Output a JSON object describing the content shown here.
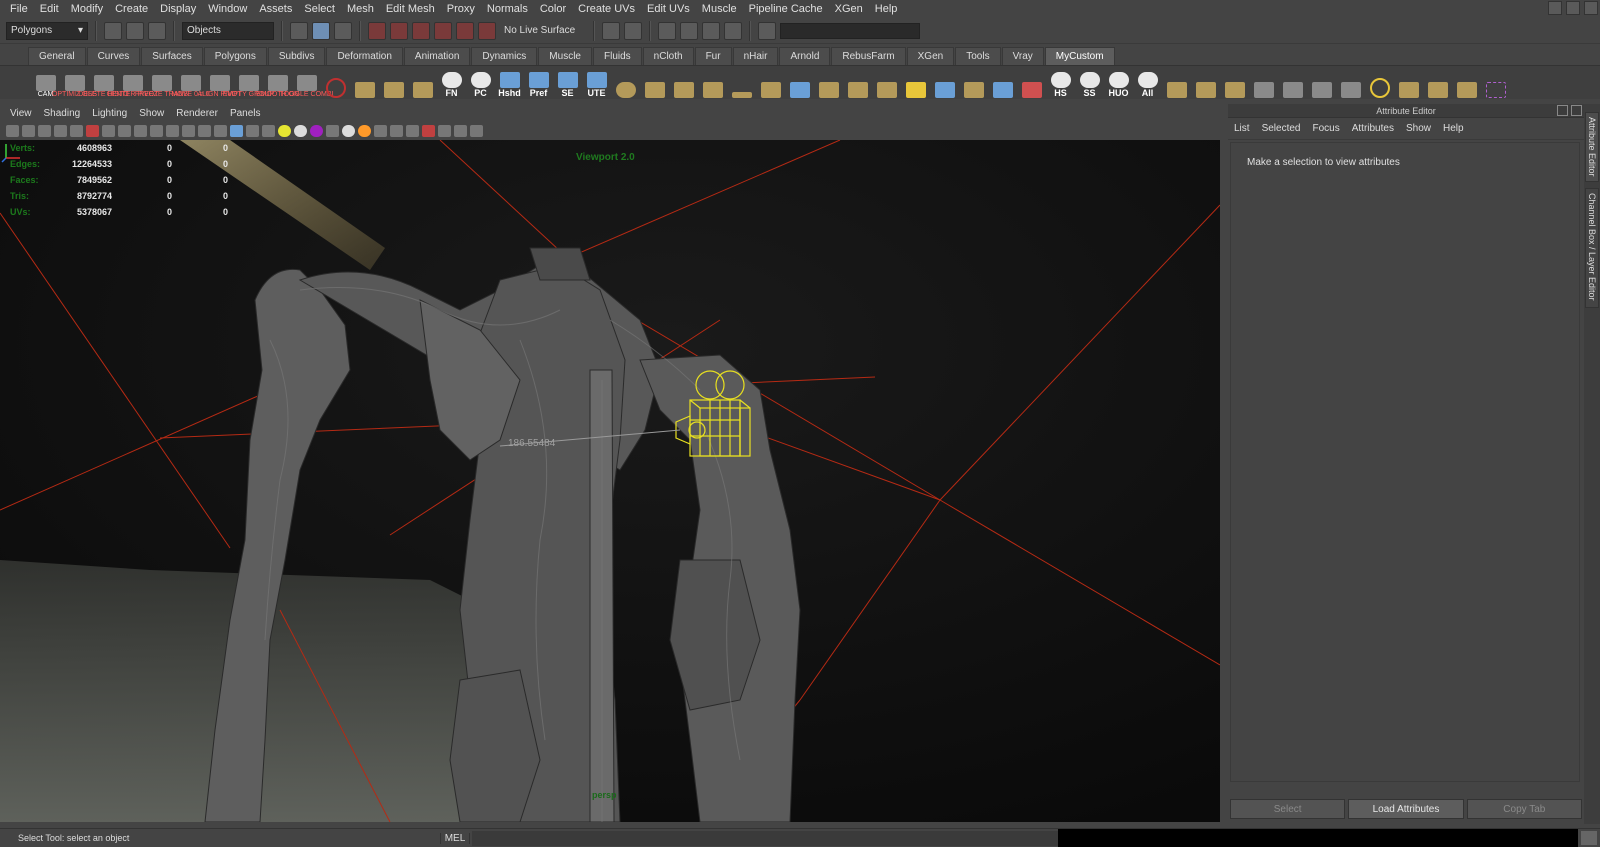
{
  "menubar": {
    "items": [
      "File",
      "Edit",
      "Modify",
      "Create",
      "Display",
      "Window",
      "Assets",
      "Select",
      "Mesh",
      "Edit Mesh",
      "Proxy",
      "Normals",
      "Color",
      "Create UVs",
      "Edit UVs",
      "Muscle",
      "Pipeline Cache",
      "XGen",
      "Help"
    ]
  },
  "statusline": {
    "menuset": "Polygons",
    "select_mode": "Objects",
    "live_surface": "No Live Surface"
  },
  "shelf": {
    "tabs": [
      "General",
      "Curves",
      "Surfaces",
      "Polygons",
      "Subdivs",
      "Deformation",
      "Animation",
      "Dynamics",
      "Muscle",
      "Fluids",
      "nCloth",
      "Fur",
      "nHair",
      "Arnold",
      "RebusFarm",
      "XGen",
      "Tools",
      "Vray",
      "MyCustom"
    ],
    "active_tab": "MyCustom",
    "buttons": [
      {
        "label": "CAM",
        "type": "white"
      },
      {
        "label": "OPTIMIZ OSS",
        "type": "red"
      },
      {
        "label": "DELETE HISTO",
        "type": "red"
      },
      {
        "label": "CENTER PIVOT",
        "type": "red"
      },
      {
        "label": "FREEZE TRANS",
        "type": "red"
      },
      {
        "label": "MOVE 0 n 0",
        "type": "red"
      },
      {
        "label": "ALIGN PIVOT",
        "type": "red"
      },
      {
        "label": "EMPTY GROUP",
        "type": "red"
      },
      {
        "label": "SMOOTH ON",
        "type": "red"
      },
      {
        "label": "TOGGLE COMBI",
        "type": "red"
      },
      {
        "label": "FN",
        "type": "eye"
      },
      {
        "label": "PC",
        "type": "eye"
      },
      {
        "label": "Hshd",
        "type": "blue"
      },
      {
        "label": "Pref",
        "type": "blue"
      },
      {
        "label": "SE",
        "type": "blue"
      },
      {
        "label": "UTE",
        "type": "blue"
      },
      {
        "label": "HS",
        "type": "eye"
      },
      {
        "label": "SS",
        "type": "eye"
      },
      {
        "label": "HUO",
        "type": "eye"
      },
      {
        "label": "All",
        "type": "eye"
      }
    ]
  },
  "panel": {
    "menu": [
      "View",
      "Shading",
      "Lighting",
      "Show",
      "Renderer",
      "Panels"
    ]
  },
  "viewport": {
    "label": "Viewport 2.0",
    "dimension": "186.55484",
    "camera": "persp",
    "hud": [
      {
        "label": "Verts:",
        "v1": "4608963",
        "v2": "0",
        "v3": "0"
      },
      {
        "label": "Edges:",
        "v1": "12264533",
        "v2": "0",
        "v3": "0"
      },
      {
        "label": "Faces:",
        "v1": "7849562",
        "v2": "0",
        "v3": "0"
      },
      {
        "label": "Tris:",
        "v1": "8792774",
        "v2": "0",
        "v3": "0"
      },
      {
        "label": "UVs:",
        "v1": "5378067",
        "v2": "0",
        "v3": "0"
      }
    ]
  },
  "attribute_editor": {
    "title": "Attribute Editor",
    "menu": [
      "List",
      "Selected",
      "Focus",
      "Attributes",
      "Show",
      "Help"
    ],
    "message": "Make a selection to view attributes",
    "buttons": {
      "select": "Select",
      "load": "Load Attributes",
      "copy": "Copy Tab"
    }
  },
  "side_tabs": {
    "attribute": "Attribute Editor",
    "channel": "Channel Box / Layer Editor"
  },
  "helpline": {
    "text": "Select Tool: select an object",
    "mel": "MEL"
  }
}
